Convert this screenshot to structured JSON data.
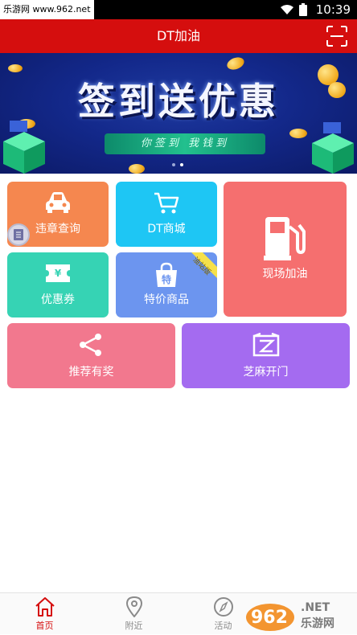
{
  "status_bar": {
    "watermark": "乐游网 www.962.net",
    "time": "10:39"
  },
  "header": {
    "title": "DT加油"
  },
  "banner": {
    "headline": "签到送优惠",
    "subline": "你签到 我钱到",
    "slides": 2,
    "active_slide": 2
  },
  "tiles": {
    "violation": {
      "label": "违章查询",
      "color": "#f5874f"
    },
    "mall": {
      "label": "DT商城",
      "color": "#1ec6f4"
    },
    "refuel": {
      "label": "现场加油",
      "color": "#f56f6f"
    },
    "coupon": {
      "label": "优惠券",
      "color": "#36d3b4"
    },
    "special": {
      "label": "特价商品",
      "color": "#6c95ef",
      "tag": "油站版"
    },
    "recommend": {
      "label": "推荐有奖",
      "color": "#f2788e"
    },
    "sesame": {
      "label": "芝麻开门",
      "color": "#a46bf0"
    }
  },
  "tabbar": {
    "home": "首页",
    "nearby": "附近",
    "activity": "活动",
    "mine": ""
  },
  "watermark_962": {
    "text": "962.NET",
    "sub": "乐游网"
  }
}
